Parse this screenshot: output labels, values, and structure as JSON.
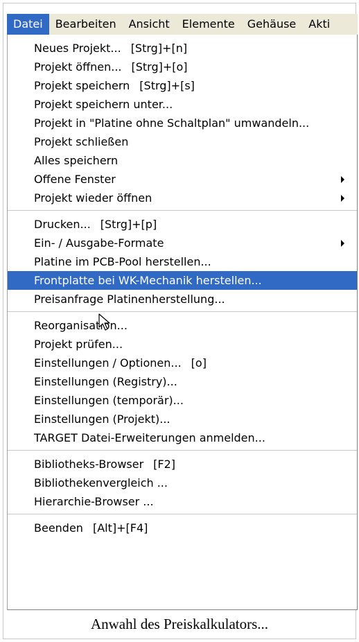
{
  "menubar": {
    "items": [
      {
        "label": "Datei"
      },
      {
        "label": "Bearbeiten"
      },
      {
        "label": "Ansicht"
      },
      {
        "label": "Elemente"
      },
      {
        "label": "Gehäuse"
      },
      {
        "label": "Akti"
      }
    ]
  },
  "menu": {
    "groups": [
      [
        {
          "label": "Neues Projekt...",
          "shortcut": "[Strg]+[n]"
        },
        {
          "label": "Projekt öffnen...",
          "shortcut": "[Strg]+[o]"
        },
        {
          "label": "Projekt speichern",
          "shortcut": "[Strg]+[s]"
        },
        {
          "label": "Projekt speichern unter...",
          "shortcut": ""
        },
        {
          "label": "Projekt in \"Platine ohne Schaltplan\" umwandeln...",
          "shortcut": ""
        },
        {
          "label": "Projekt schließen",
          "shortcut": ""
        },
        {
          "label": "Alles speichern",
          "shortcut": ""
        },
        {
          "label": "Offene Fenster",
          "shortcut": ""
        },
        {
          "label": "Projekt wieder öffnen",
          "shortcut": ""
        }
      ],
      [
        {
          "label": "Drucken...",
          "shortcut": "[Strg]+[p]"
        },
        {
          "label": "Ein- / Ausgabe-Formate",
          "shortcut": ""
        },
        {
          "label": "Platine im PCB-Pool herstellen...",
          "shortcut": ""
        },
        {
          "label": "Frontplatte bei WK-Mechanik herstellen...",
          "shortcut": ""
        },
        {
          "label": "Preisanfrage Platinenherstellung...",
          "shortcut": ""
        }
      ],
      [
        {
          "label": "Reorganisation...",
          "shortcut": ""
        },
        {
          "label": "Projekt prüfen...",
          "shortcut": ""
        },
        {
          "label": "Einstellungen / Optionen...",
          "shortcut": "[o]"
        },
        {
          "label": "Einstellungen (Registry)...",
          "shortcut": ""
        },
        {
          "label": "Einstellungen (temporär)...",
          "shortcut": ""
        },
        {
          "label": "Einstellungen (Projekt)...",
          "shortcut": ""
        },
        {
          "label": "TARGET Datei-Erweiterungen anmelden...",
          "shortcut": ""
        }
      ],
      [
        {
          "label": "Bibliotheks-Browser",
          "shortcut": "[F2]"
        },
        {
          "label": "Bibliothekenvergleich ...",
          "shortcut": ""
        },
        {
          "label": "Hierarchie-Browser ...",
          "shortcut": ""
        }
      ],
      [
        {
          "label": "Beenden",
          "shortcut": "[Alt]+[F4]"
        }
      ]
    ]
  },
  "caption": "Anwahl des Preiskalkulators...",
  "colors": {
    "highlight": "#316ac5",
    "menubar": "#ece9d8"
  }
}
